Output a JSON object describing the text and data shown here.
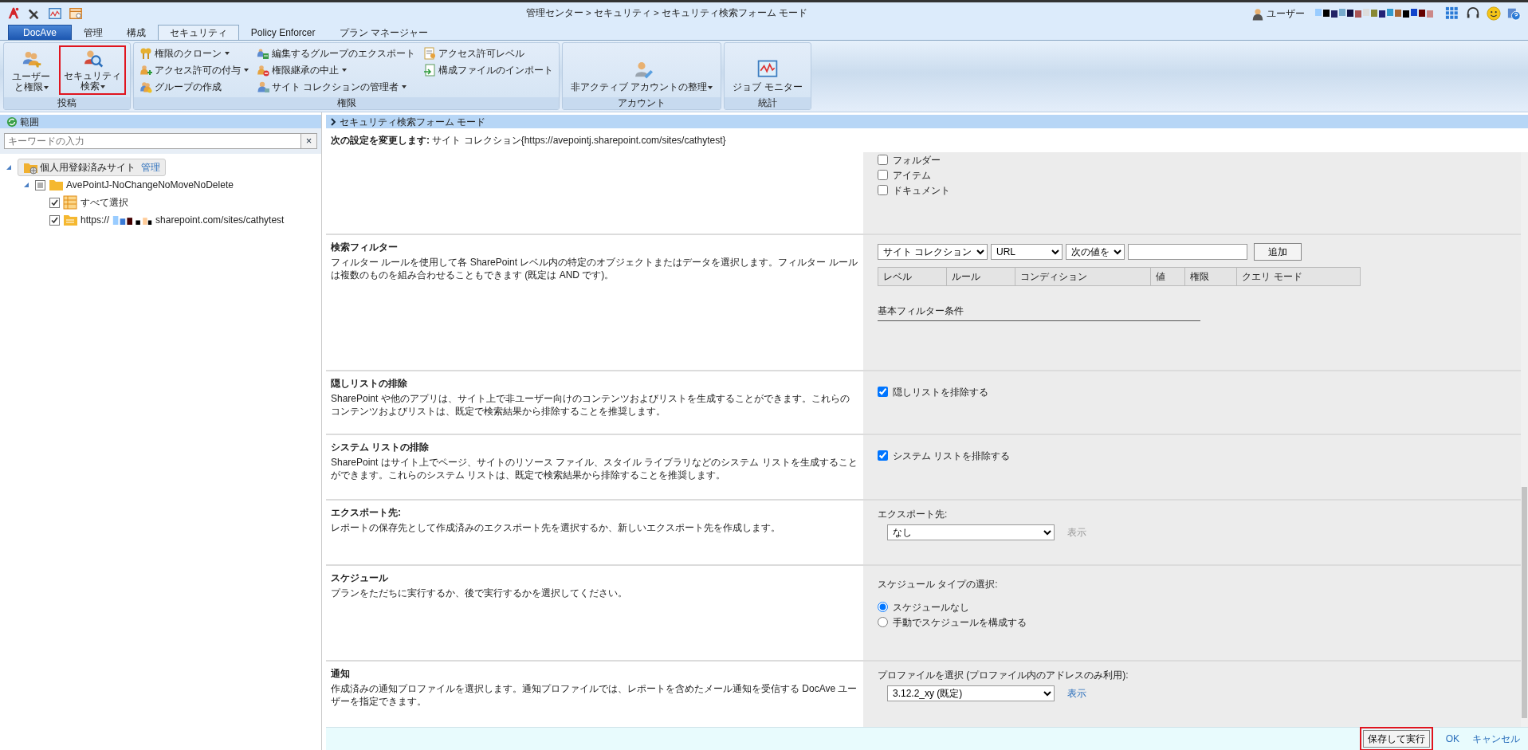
{
  "top_bar": {
    "breadcrumb": "管理センター > セキュリティ > セキュリティ検索フォーム モード",
    "user_label": "ユーザー"
  },
  "tabs": [
    {
      "label": "DocAve",
      "kind": "app",
      "selected": false
    },
    {
      "label": "管理",
      "kind": "tab",
      "selected": false
    },
    {
      "label": "構成",
      "kind": "tab",
      "selected": false
    },
    {
      "label": "セキュリティ",
      "kind": "tab",
      "selected": true
    },
    {
      "label": "Policy Enforcer",
      "kind": "tab",
      "selected": false
    },
    {
      "label": "プラン マネージャー",
      "kind": "tab",
      "selected": false
    }
  ],
  "ribbon": [
    {
      "label": "投稿",
      "kind": "large",
      "buttons": [
        {
          "lines": [
            "ユーザー",
            "と権限"
          ],
          "dropdown": true,
          "highlighted": false
        },
        {
          "lines": [
            "セキュリティ",
            "検索"
          ],
          "dropdown": true,
          "highlighted": true
        }
      ]
    },
    {
      "label": "権限",
      "kind": "small",
      "columns": [
        [
          {
            "label": "権限のクローン",
            "dropdown": true
          },
          {
            "label": "アクセス許可の付与",
            "dropdown": true
          },
          {
            "label": "グループの作成",
            "dropdown": false
          }
        ],
        [
          {
            "label": "編集するグループのエクスポート",
            "dropdown": false
          },
          {
            "label": "権限継承の中止",
            "dropdown": true
          },
          {
            "label": "サイト コレクションの管理者",
            "dropdown": true
          }
        ],
        [
          {
            "label": "アクセス許可レベル",
            "dropdown": false
          },
          {
            "label": "構成ファイルのインポート",
            "dropdown": false
          }
        ]
      ]
    },
    {
      "label": "アカウント",
      "kind": "large",
      "buttons": [
        {
          "lines": [
            "非アクティブ アカウントの整理"
          ],
          "dropdown": true,
          "highlighted": false
        }
      ]
    },
    {
      "label": "統計",
      "kind": "large",
      "buttons": [
        {
          "lines": [
            "ジョブ モニター"
          ],
          "dropdown": false,
          "highlighted": false
        }
      ]
    }
  ],
  "scope_panel": {
    "title": "範囲",
    "search": {
      "placeholder": "キーワードの入力",
      "clear": "×"
    },
    "tree": [
      {
        "label": "個人用登録済みサイト",
        "action": "管理",
        "expanded": true,
        "children": [
          {
            "label": "AvePointJ-NoChangeNoMoveNoDelete",
            "checked": false,
            "indeterminate": true,
            "expanded": true,
            "children": [
              {
                "label": "すべて選択",
                "checked": true
              },
              {
                "prefix": "https://",
                "label": "sharepoint.com/sites/cathytest",
                "checked": true
              }
            ]
          }
        ]
      }
    ]
  },
  "form": {
    "header": "セキュリティ検索フォーム モード",
    "notice": "**次の設定を変更します:** サイト コレクション{https://avepointj.sharepoint.com/sites/cathytest}",
    "sections": [
      {
        "kind": "checklist",
        "items": [
          {
            "label": "フォルダー",
            "checked": false
          },
          {
            "label": "アイテム",
            "checked": false
          },
          {
            "label": "ドキュメント",
            "checked": false
          }
        ]
      },
      {
        "kind": "filter",
        "title": "検索フィルター",
        "description": "フィルター ルールを使用して各 SharePoint レベル内の特定のオブジェクトまたはデータを選択します。フィルター ルールは複数のものを組み合わせることもできます (既定は AND です)。",
        "selects": [
          "サイト コレクション",
          "URL",
          "次の値を"
        ],
        "add_button": "追加",
        "columns": [
          "レベル",
          "ルール",
          "コンディション",
          "値",
          "権限",
          "クエリ モード"
        ],
        "basic_label": "基本フィルター条件"
      },
      {
        "kind": "checkbox",
        "title": "隠しリストの排除",
        "description": "SharePoint や他のアプリは、サイト上で非ユーザー向けのコンテンツおよびリストを生成することができます。これらのコンテンツおよびリストは、既定で検索結果から排除することを推奨します。",
        "option": {
          "label": "隠しリストを排除する",
          "checked": true
        }
      },
      {
        "kind": "checkbox",
        "title": "システム リストの排除",
        "description": "SharePoint はサイト上でページ、サイトのリソース ファイル、スタイル ライブラリなどのシステム リストを生成することができます。これらのシステム リストは、既定で検索結果から排除することを推奨します。",
        "option": {
          "label": "システム リストを排除する",
          "checked": true
        }
      },
      {
        "kind": "select",
        "title": "エクスポート先:",
        "description": "レポートの保存先として作成済みのエクスポート先を選択するか、新しいエクスポート先を作成します。",
        "field_label": "エクスポート先:",
        "value": "なし",
        "link": "表示",
        "link_disabled": true
      },
      {
        "kind": "radio",
        "title": "スケジュール",
        "description": "プランをただちに実行するか、後で実行するかを選択してください。",
        "field_label": "スケジュール タイプの選択:",
        "options": [
          {
            "label": "スケジュールなし",
            "selected": true
          },
          {
            "label": "手動でスケジュールを構成する",
            "selected": false
          }
        ]
      },
      {
        "kind": "select",
        "title": "通知",
        "description": "作成済みの通知プロファイルを選択します。通知プロファイルでは、レポートを含めたメール通知を受信する DocAve ユーザーを指定できます。",
        "field_label": "プロファイルを選択 (プロファイル内のアドレスのみ利用):",
        "value": "3.12.2_xy (既定)",
        "link": "表示",
        "link_disabled": false
      }
    ]
  },
  "footer": [
    {
      "label": "保存して実行",
      "kind": "button",
      "highlighted": true
    },
    {
      "label": "OK",
      "kind": "link",
      "highlighted": false
    },
    {
      "label": "キャンセル",
      "kind": "link",
      "highlighted": false
    }
  ]
}
